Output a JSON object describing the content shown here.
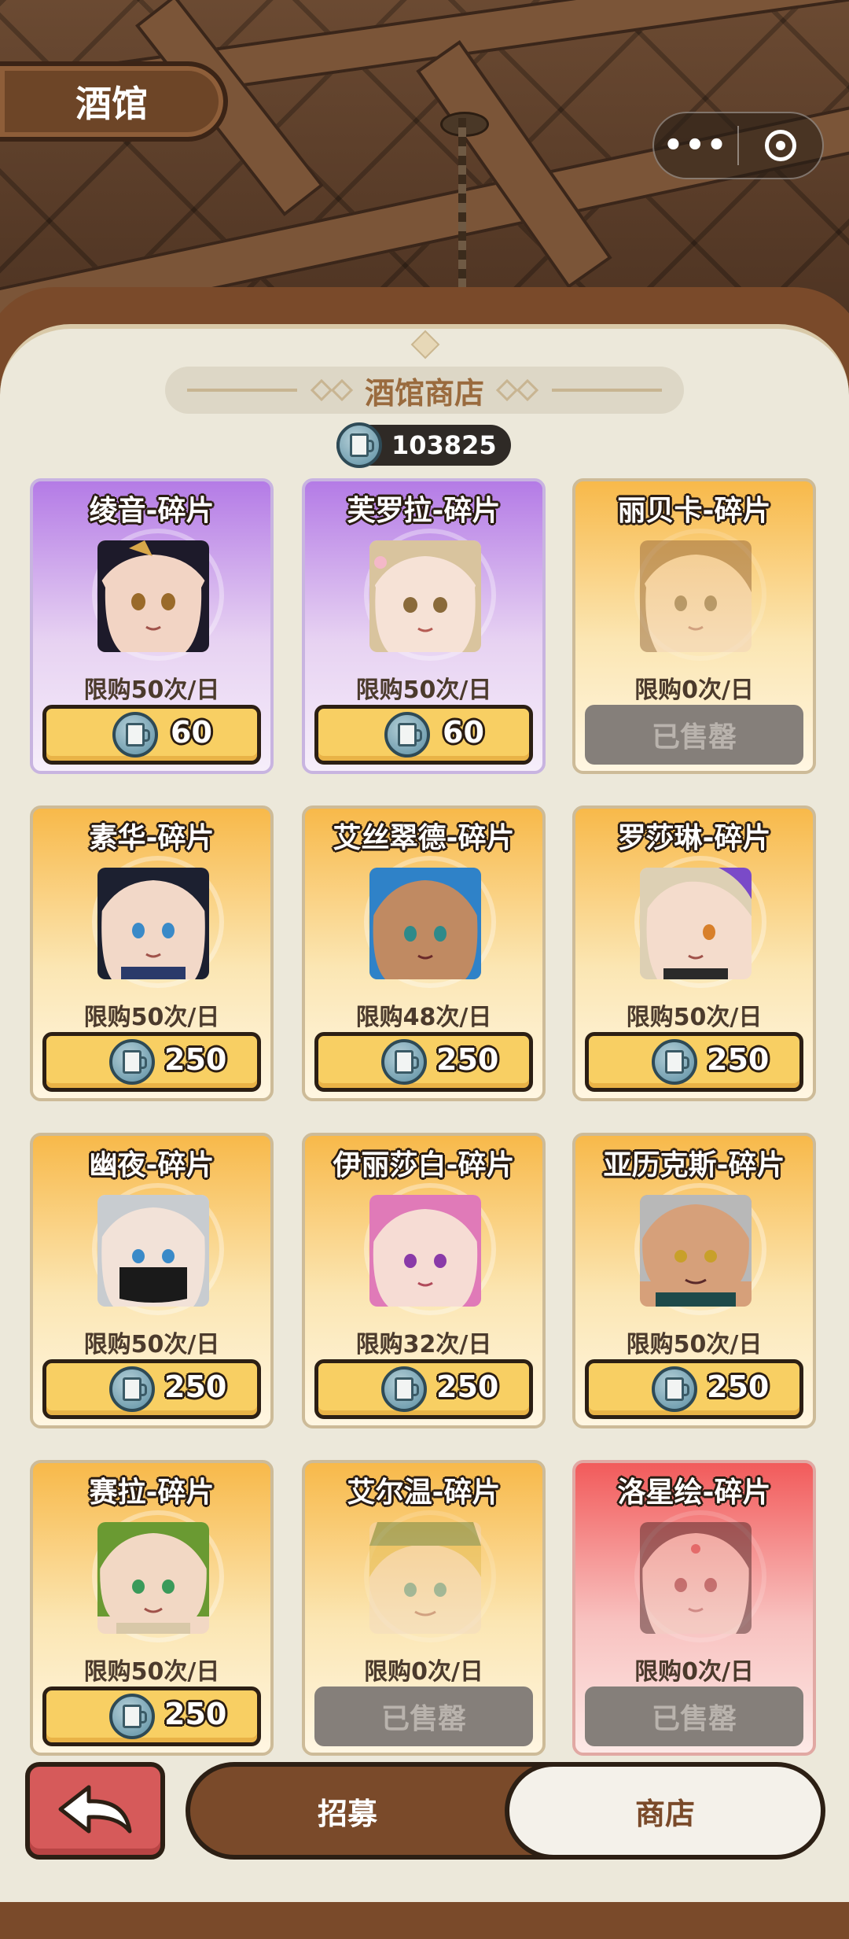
{
  "header": {
    "title": "酒馆"
  },
  "shop": {
    "title": "酒馆商店",
    "currency_amount": "103825",
    "currency_icon": "ale-mug-coin-icon"
  },
  "items": [
    {
      "name": "绫音-碎片",
      "limit": "限购50次/日",
      "price": "60",
      "sold_out": false,
      "theme": "purple"
    },
    {
      "name": "芙罗拉-碎片",
      "limit": "限购50次/日",
      "price": "60",
      "sold_out": false,
      "theme": "purple"
    },
    {
      "name": "丽贝卡-碎片",
      "limit": "限购0次/日",
      "price": "已售罄",
      "sold_out": true,
      "theme": "orange"
    },
    {
      "name": "素华-碎片",
      "limit": "限购50次/日",
      "price": "250",
      "sold_out": false,
      "theme": "orange"
    },
    {
      "name": "艾丝翠德-碎片",
      "limit": "限购48次/日",
      "price": "250",
      "sold_out": false,
      "theme": "orange"
    },
    {
      "name": "罗莎琳-碎片",
      "limit": "限购50次/日",
      "price": "250",
      "sold_out": false,
      "theme": "orange"
    },
    {
      "name": "幽夜-碎片",
      "limit": "限购50次/日",
      "price": "250",
      "sold_out": false,
      "theme": "orange"
    },
    {
      "name": "伊丽莎白-碎片",
      "limit": "限购32次/日",
      "price": "250",
      "sold_out": false,
      "theme": "orange"
    },
    {
      "name": "亚历克斯-碎片",
      "limit": "限购50次/日",
      "price": "250",
      "sold_out": false,
      "theme": "orange"
    },
    {
      "name": "赛拉-碎片",
      "limit": "限购50次/日",
      "price": "250",
      "sold_out": false,
      "theme": "orange"
    },
    {
      "name": "艾尔温-碎片",
      "limit": "限购0次/日",
      "price": "已售罄",
      "sold_out": true,
      "theme": "orange"
    },
    {
      "name": "洛星绘-碎片",
      "limit": "限购0次/日",
      "price": "已售罄",
      "sold_out": true,
      "theme": "red"
    }
  ],
  "bottom_nav": {
    "back_icon": "back-arrow-icon",
    "tabs": [
      {
        "label": "招募",
        "active": false
      },
      {
        "label": "商店",
        "active": true
      }
    ]
  },
  "colors": {
    "purple_card": "#b47be6",
    "orange_card": "#f8b94a",
    "red_card": "#f25b5b",
    "buy_button": "#f8cf63",
    "sold_button": "#857f7a",
    "wood": "#7a4a2a"
  }
}
